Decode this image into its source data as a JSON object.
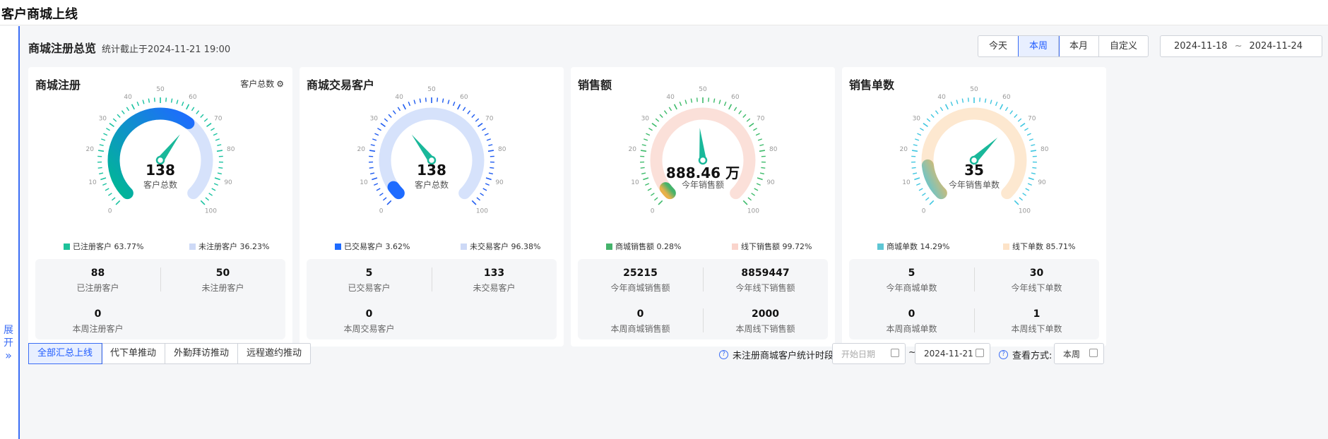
{
  "page": {
    "title": "客户商城上线"
  },
  "side": {
    "expand_label": "展开",
    "expand_arrow": "»"
  },
  "overview": {
    "title": "商城注册总览",
    "note": "统计截止于2024-11-21 19:00"
  },
  "period_tabs": [
    {
      "label": "今天"
    },
    {
      "label": "本周",
      "active": true
    },
    {
      "label": "本月"
    },
    {
      "label": "自定义"
    }
  ],
  "date_range": {
    "start": "2024-11-18",
    "sep": "~",
    "end": "2024-11-24"
  },
  "gauge_ticks": [
    "0",
    "10",
    "20",
    "30",
    "40",
    "50",
    "60",
    "70",
    "80",
    "90",
    "100"
  ],
  "cards": [
    {
      "title": "商城注册",
      "extra": "客户总数",
      "extra_icon": "gear-icon",
      "value": "138",
      "value_label": "客户总数",
      "progress_pct": 63.77,
      "pointer_pct": 63.77,
      "colors": {
        "track": "#d6e2fb",
        "bar_start": "#00b894",
        "bar_end": "#1e6bff",
        "ticks": "#19c2a0",
        "pointer": "#19b89a"
      },
      "legend": [
        {
          "label": "已注册客户 63.77%",
          "color": "#1ec29a"
        },
        {
          "label": "未注册客户 36.23%",
          "color": "#cdd9f6"
        }
      ],
      "stats": [
        {
          "num": "88",
          "label": "已注册客户"
        },
        {
          "num": "50",
          "label": "未注册客户"
        },
        {
          "num": "0",
          "label": "本周注册客户"
        }
      ]
    },
    {
      "title": "商城交易客户",
      "value": "138",
      "value_label": "客户总数",
      "progress_pct": 3.62,
      "pointer_pct": 36.0,
      "colors": {
        "track": "#d6e2fb",
        "bar_start": "#1e6bff",
        "bar_end": "#1e6bff",
        "ticks": "#1e5bf0",
        "pointer": "#19b89a"
      },
      "legend": [
        {
          "label": "已交易客户 3.62%",
          "color": "#1e6bff"
        },
        {
          "label": "未交易客户 96.38%",
          "color": "#cdd9f6"
        }
      ],
      "stats": [
        {
          "num": "5",
          "label": "已交易客户"
        },
        {
          "num": "133",
          "label": "未交易客户"
        },
        {
          "num": "0",
          "label": "本周交易客户"
        }
      ]
    },
    {
      "title": "销售额",
      "value": "888.46 万",
      "value_label": "今年销售额",
      "progress_pct": 0.28,
      "pointer_pct": 48.0,
      "colors": {
        "track": "#fbe0d9",
        "bar_start": "#e8b14a",
        "bar_end": "#45b36b",
        "ticks": "#3dbb6b",
        "pointer": "#19b89a"
      },
      "legend": [
        {
          "label": "商城销售额 0.28%",
          "color": "#45b36b"
        },
        {
          "label": "线下销售额 99.72%",
          "color": "#fad4cc"
        }
      ],
      "stats": [
        {
          "num": "25215",
          "label": "今年商城销售额"
        },
        {
          "num": "8859447",
          "label": "今年线下销售额"
        },
        {
          "num": "0",
          "label": "本周商城销售额"
        },
        {
          "num": "2000",
          "label": "本周线下销售额"
        }
      ]
    },
    {
      "title": "销售单数",
      "value": "35",
      "value_label": "今年销售单数",
      "progress_pct": 14.29,
      "pointer_pct": 67.0,
      "colors": {
        "track": "#fde8d0",
        "bar_start": "#5ec6d4",
        "bar_end": "#e9b860",
        "ticks": "#3fc6e0",
        "pointer": "#19b89a"
      },
      "legend": [
        {
          "label": "商城单数 14.29%",
          "color": "#5ec6d4"
        },
        {
          "label": "线下单数 85.71%",
          "color": "#fde3c8"
        }
      ],
      "stats": [
        {
          "num": "5",
          "label": "今年商城单数"
        },
        {
          "num": "30",
          "label": "今年线下单数"
        },
        {
          "num": "0",
          "label": "本周商城单数"
        },
        {
          "num": "1",
          "label": "本周线下单数"
        }
      ]
    }
  ],
  "bottom_tabs": [
    {
      "label": "全部汇总上线",
      "active": true
    },
    {
      "label": "代下单推动"
    },
    {
      "label": "外勤拜访推动"
    },
    {
      "label": "远程邀约推动"
    }
  ],
  "filters": {
    "help_icon": "question-circle-icon",
    "unreg_label": "未注册商城客户统计时段:",
    "start_placeholder": "开始日期",
    "tilde": "~",
    "end_date": "2024-11-21",
    "view_label": "查看方式:",
    "view_value": "本周"
  }
}
